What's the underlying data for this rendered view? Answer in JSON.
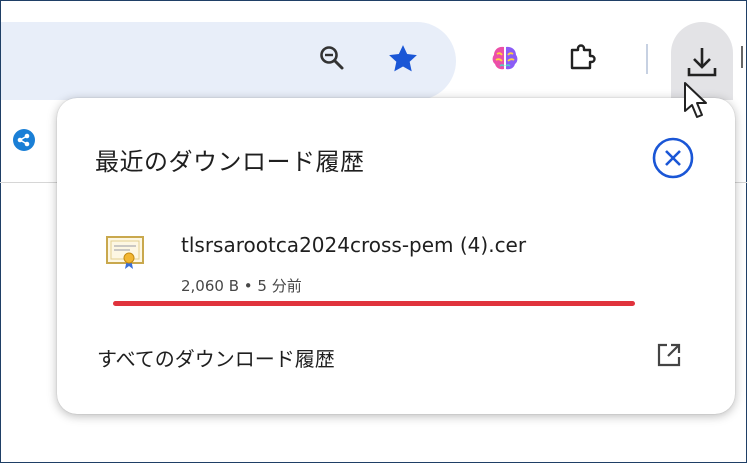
{
  "toolbar": {
    "zoom_icon": "zoom-out-icon",
    "bookmark_icon": "star-icon",
    "extension_icon": "brain-icon",
    "extensions_icon": "puzzle-icon",
    "downloads_icon": "download-icon"
  },
  "download_panel": {
    "title": "最近のダウンロード履歴",
    "close_icon": "close-circle-icon",
    "items": [
      {
        "file_name": "tlsrsarootca2024cross-pem (4).cer",
        "meta": "2,060 B • 5 分前",
        "icon": "certificate-icon"
      }
    ],
    "show_all_label": "すべてのダウンロード履歴",
    "open_external_icon": "open-in-new-icon"
  },
  "colors": {
    "accent_blue": "#1a56d6",
    "omnibox_bg": "#e8eef9",
    "highlight_red": "#e0333c"
  }
}
